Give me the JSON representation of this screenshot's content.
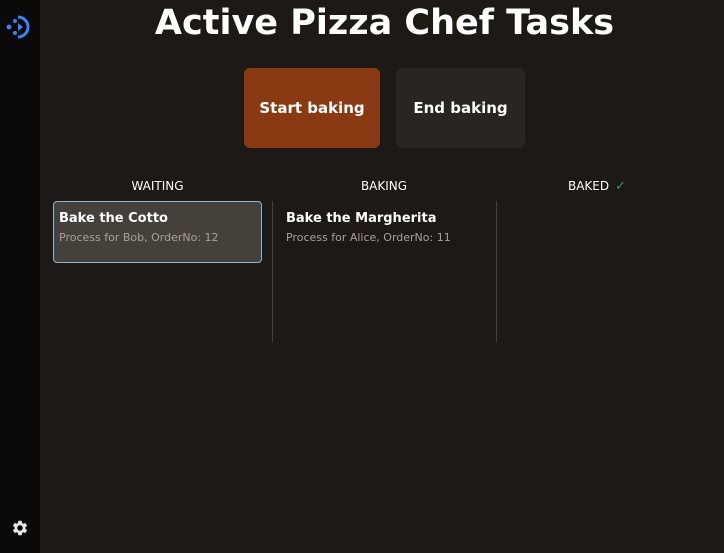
{
  "app": {
    "title": "Active Pizza Chef Tasks"
  },
  "sidebar": {
    "logo_icon": "workflow-logo-icon",
    "settings_icon": "gear-icon"
  },
  "actions": {
    "start_label": "Start baking",
    "end_label": "End baking"
  },
  "columns": [
    {
      "label": "WAITING"
    },
    {
      "label": "BAKING"
    },
    {
      "label": "BAKED",
      "icon": "checkmark-icon"
    }
  ],
  "tasks": [
    {
      "title": "Bake the Cotto",
      "subtitle": "Process for Bob, OrderNo: 12",
      "column": "WAITING",
      "selected": true
    },
    {
      "title": "Bake the Margherita",
      "subtitle": "Process for Alice, OrderNo: 11",
      "column": "BAKING",
      "selected": false
    }
  ],
  "colors": {
    "background": "#1c1917",
    "sidebar": "#0a0a0a",
    "start_button": "#8a3a12",
    "end_button": "#292524",
    "accent_blue": "#3b82f6",
    "check_green": "#22a355",
    "selected_border": "#93b4d4"
  }
}
